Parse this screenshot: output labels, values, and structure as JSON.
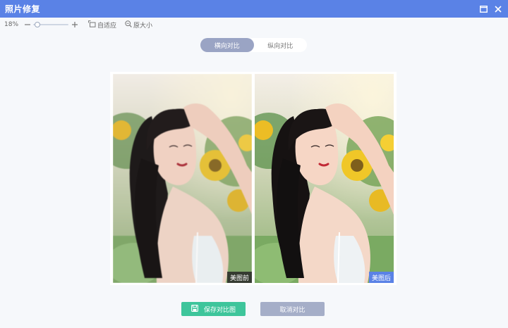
{
  "window": {
    "title": "照片修复",
    "maximize_icon": "maximize-icon",
    "close_icon": "close-icon"
  },
  "toolbar": {
    "zoom_value": "18%",
    "zoom_level": 0.05,
    "fit_label": "自适应",
    "original_label": "原大小"
  },
  "view_mode": {
    "options": [
      "横向对比",
      "纵向对比"
    ],
    "selected": "横向对比"
  },
  "compare": {
    "before_label": "美图前",
    "after_label": "美图后"
  },
  "actions": {
    "save_label": "保存对比图",
    "cancel_label": "取消对比"
  },
  "colors": {
    "titlebar": "#5a82e6",
    "save_button": "#3ec59b",
    "cancel_button": "#a5aec8",
    "after_tag": "#5a82e6"
  }
}
